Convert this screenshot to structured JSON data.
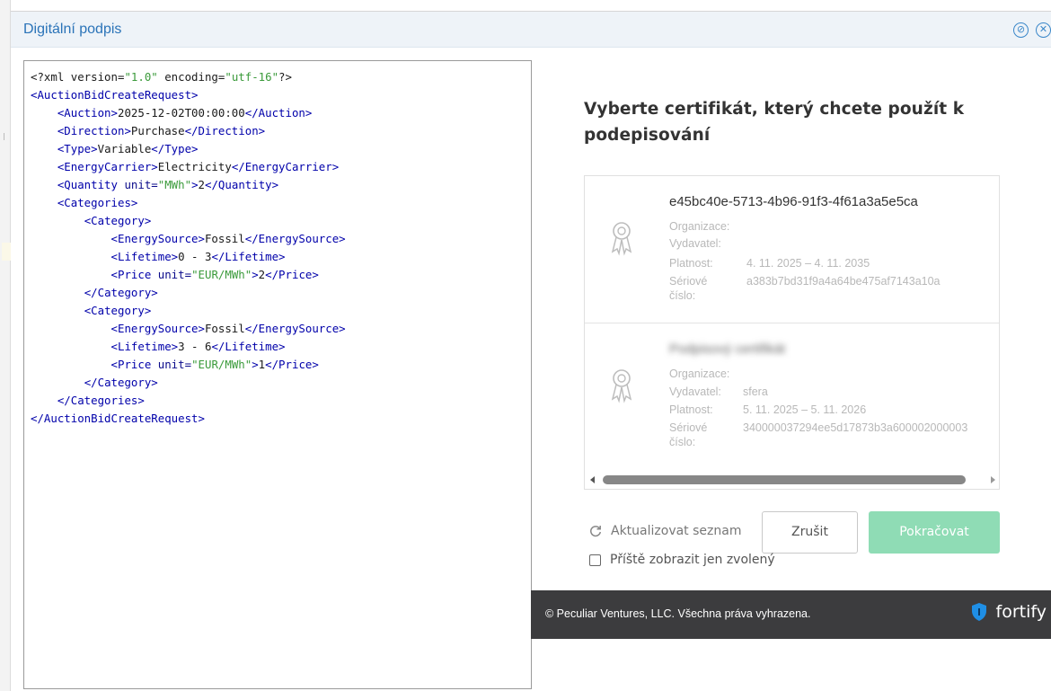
{
  "dialog": {
    "title": "Digitální podpis"
  },
  "xml": {
    "lines": [
      {
        "indent": 0,
        "parts": [
          [
            "d",
            "<?xml version="
          ],
          [
            "s",
            "\"1.0\""
          ],
          [
            "d",
            " encoding="
          ],
          [
            "s",
            "\"utf-16\""
          ],
          [
            "d",
            "?>"
          ]
        ]
      },
      {
        "indent": 0,
        "parts": [
          [
            "t",
            "<AuctionBidCreateRequest>"
          ]
        ]
      },
      {
        "indent": 1,
        "parts": [
          [
            "t",
            "<Auction>"
          ],
          [
            "v",
            "2025-12-02T00:00:00"
          ],
          [
            "t",
            "</Auction>"
          ]
        ]
      },
      {
        "indent": 1,
        "parts": [
          [
            "t",
            "<Direction>"
          ],
          [
            "v",
            "Purchase"
          ],
          [
            "t",
            "</Direction>"
          ]
        ]
      },
      {
        "indent": 1,
        "parts": [
          [
            "t",
            "<Type>"
          ],
          [
            "v",
            "Variable"
          ],
          [
            "t",
            "</Type>"
          ]
        ]
      },
      {
        "indent": 1,
        "parts": [
          [
            "t",
            "<EnergyCarrier>"
          ],
          [
            "v",
            "Electricity"
          ],
          [
            "t",
            "</EnergyCarrier>"
          ]
        ]
      },
      {
        "indent": 1,
        "parts": [
          [
            "t",
            "<Quantity "
          ],
          [
            "a",
            "unit="
          ],
          [
            "s",
            "\"MWh\""
          ],
          [
            "t",
            ">"
          ],
          [
            "v",
            "2"
          ],
          [
            "t",
            "</Quantity>"
          ]
        ]
      },
      {
        "indent": 1,
        "parts": [
          [
            "t",
            "<Categories>"
          ]
        ]
      },
      {
        "indent": 2,
        "parts": [
          [
            "t",
            "<Category>"
          ]
        ]
      },
      {
        "indent": 3,
        "parts": [
          [
            "t",
            "<EnergySource>"
          ],
          [
            "v",
            "Fossil"
          ],
          [
            "t",
            "</EnergySource>"
          ]
        ]
      },
      {
        "indent": 3,
        "parts": [
          [
            "t",
            "<Lifetime>"
          ],
          [
            "v",
            "0 - 3"
          ],
          [
            "t",
            "</Lifetime>"
          ]
        ]
      },
      {
        "indent": 3,
        "parts": [
          [
            "t",
            "<Price "
          ],
          [
            "a",
            "unit="
          ],
          [
            "s",
            "\"EUR/MWh\""
          ],
          [
            "t",
            ">"
          ],
          [
            "v",
            "2"
          ],
          [
            "t",
            "</Price>"
          ]
        ]
      },
      {
        "indent": 2,
        "parts": [
          [
            "t",
            "</Category>"
          ]
        ]
      },
      {
        "indent": 2,
        "parts": [
          [
            "t",
            "<Category>"
          ]
        ]
      },
      {
        "indent": 3,
        "parts": [
          [
            "t",
            "<EnergySource>"
          ],
          [
            "v",
            "Fossil"
          ],
          [
            "t",
            "</EnergySource>"
          ]
        ]
      },
      {
        "indent": 3,
        "parts": [
          [
            "t",
            "<Lifetime>"
          ],
          [
            "v",
            "3 - 6"
          ],
          [
            "t",
            "</Lifetime>"
          ]
        ]
      },
      {
        "indent": 3,
        "parts": [
          [
            "t",
            "<Price "
          ],
          [
            "a",
            "unit="
          ],
          [
            "s",
            "\"EUR/MWh\""
          ],
          [
            "t",
            ">"
          ],
          [
            "v",
            "1"
          ],
          [
            "t",
            "</Price>"
          ]
        ]
      },
      {
        "indent": 2,
        "parts": [
          [
            "t",
            "</Category>"
          ]
        ]
      },
      {
        "indent": 1,
        "parts": [
          [
            "t",
            "</Categories>"
          ]
        ]
      },
      {
        "indent": 0,
        "parts": [
          [
            "t",
            "</AuctionBidCreateRequest>"
          ]
        ]
      }
    ]
  },
  "fortify": {
    "heading": "Vyberte certifikát, který chcete použít k podepisování",
    "certificates": [
      {
        "name": "e45bc40e-5713-4b96-91f3-4f61a3a5e5ca",
        "blurred": false,
        "org_label": "Organizace:",
        "org_value": "",
        "issuer_label": "Vydavatel:",
        "issuer_value": "",
        "validity_label": "Platnost:",
        "validity_value": "4. 11. 2025 – 4. 11. 2035",
        "serial_label_1": "Sériové",
        "serial_label_2": "číslo:",
        "serial_value": "a383b7bd31f9a4a64be475af7143a10a"
      },
      {
        "name": "Podpisový certifikát",
        "blurred": true,
        "org_label": "Organizace:",
        "org_value": "",
        "issuer_label": "Vydavatel:",
        "issuer_value": "sfera",
        "validity_label": "Platnost:",
        "validity_value": "5. 11. 2025 – 5. 11. 2026",
        "serial_label_1": "Sériové",
        "serial_label_2": "číslo:",
        "serial_value": "340000037294ee5d17873b3a600002000003"
      }
    ],
    "refresh_label": "Aktualizovat seznam",
    "cancel_label": "Zrušit",
    "continue_label": "Pokračovat",
    "remember_label": "Příště zobrazit jen zvolený",
    "footer_copyright": "© Peculiar Ventures, LLC. Všechna práva vyhrazena.",
    "footer_brand": "fortify"
  },
  "colors": {
    "title_blue": "#2a73b8",
    "continue_green": "#8fdcb5",
    "footer_bg": "#3c3c3e",
    "shield_blue": "#1f8fe6"
  },
  "icons": [
    "minimize-icon",
    "close-icon",
    "certificate-ribbon-icon",
    "refresh-icon",
    "fortify-shield-icon"
  ]
}
